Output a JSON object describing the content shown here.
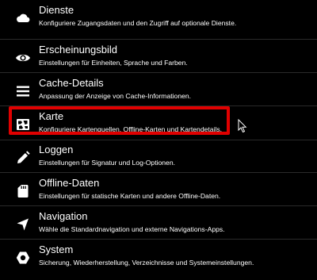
{
  "settings": {
    "items": [
      {
        "title": "Dienste",
        "description": "Konfiguriere Zugangsdaten und den Zugriff auf optionale Dienste.",
        "icon": "cloud-icon"
      },
      {
        "title": "Erscheinungsbild",
        "description": "Einstellungen für Einheiten, Sprache und Farben.",
        "icon": "eye-icon"
      },
      {
        "title": "Cache-Details",
        "description": "Anpassung der Anzeige von Cache-Informationen.",
        "icon": "list-icon"
      },
      {
        "title": "Karte",
        "description": "Konfiguriere Kartenquellen, Offline-Karten und Kartendetails.",
        "icon": "map-icon"
      },
      {
        "title": "Loggen",
        "description": "Einstellungen für Signatur und Log-Optionen.",
        "icon": "pencil-icon"
      },
      {
        "title": "Offline-Daten",
        "description": "Einstellungen für statische Karten und andere Offline-Daten.",
        "icon": "sd-card-icon"
      },
      {
        "title": "Navigation",
        "description": "Wähle die Standardnavigation und externe Navigations-Apps.",
        "icon": "navigation-arrow-icon"
      },
      {
        "title": "System",
        "description": "Sicherung, Wiederherstellung, Verzeichnisse und Systemeinstellungen.",
        "icon": "gear-icon"
      }
    ],
    "highlighted_item": "Karte",
    "highlight_color": "#e00000"
  }
}
